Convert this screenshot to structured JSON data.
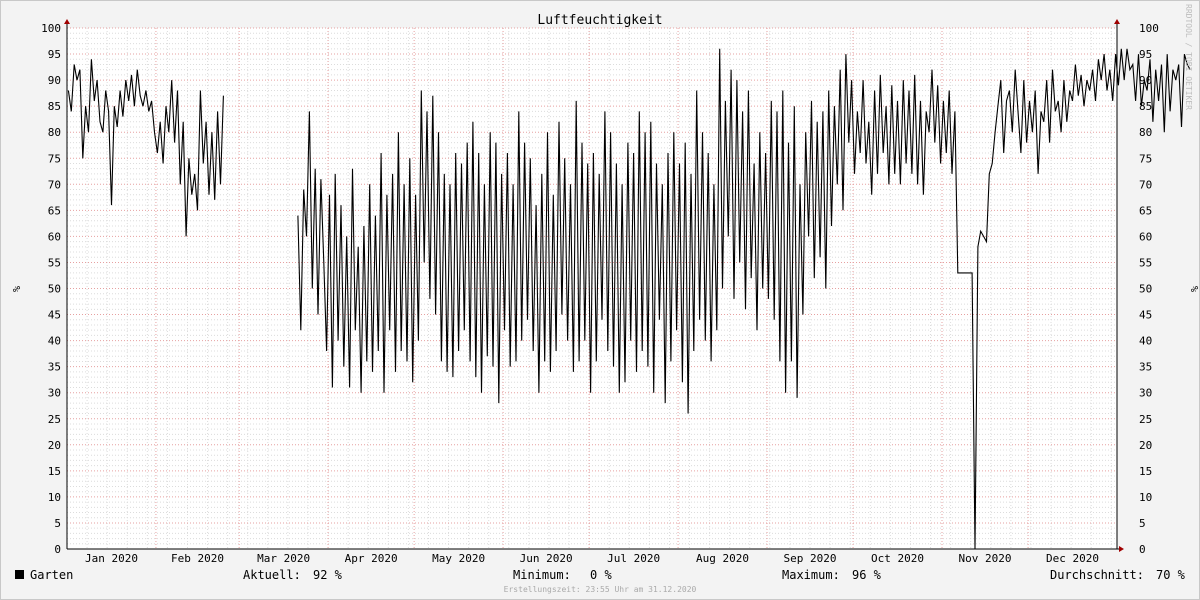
{
  "chart_data": {
    "type": "line",
    "title": "Luftfeuchtigkeit",
    "ylabel": "%",
    "ylim": [
      0,
      100
    ],
    "yticks": [
      "0",
      "5",
      "10",
      "15",
      "20",
      "25",
      "30",
      "35",
      "40",
      "45",
      "50",
      "55",
      "60",
      "65",
      "70",
      "75",
      "80",
      "85",
      "90",
      "95",
      "100"
    ],
    "xlim": [
      "2020-01-01",
      "2020-12-31"
    ],
    "month_labels": [
      "Jan 2020",
      "Feb 2020",
      "Mar 2020",
      "Apr 2020",
      "May 2020",
      "Jun 2020",
      "Jul 2020",
      "Aug 2020",
      "Sep 2020",
      "Oct 2020",
      "Nov 2020",
      "Dec 2020"
    ],
    "grid": true,
    "series": [
      {
        "name": "Garten",
        "segments": [
          {
            "start": "2020-01-01",
            "values": [
              88,
              84,
              93,
              90,
              92,
              75,
              85,
              80,
              94,
              86,
              90,
              82,
              80,
              88,
              84,
              66,
              85,
              81,
              88,
              83,
              90,
              86,
              91,
              85,
              92,
              87,
              85,
              88,
              84,
              86,
              80,
              76,
              82,
              74,
              85,
              80,
              90,
              78,
              88,
              70,
              82,
              60,
              75,
              68,
              72,
              65,
              88,
              74,
              82,
              68,
              80,
              67,
              84,
              70,
              87
            ]
          },
          {
            "start": "2020-03-21",
            "values": [
              64,
              42,
              69,
              60,
              84,
              50,
              73,
              45,
              71,
              55,
              38,
              68,
              31,
              72,
              40,
              66,
              35,
              60,
              31,
              73,
              42,
              58,
              30,
              62,
              36,
              70,
              34,
              64,
              38,
              76,
              30,
              68,
              42,
              72,
              34,
              80,
              38,
              70,
              36,
              75,
              32,
              68,
              40,
              88,
              55,
              84,
              48,
              87,
              45,
              80,
              36,
              72,
              34,
              70,
              33,
              76,
              38,
              74,
              42,
              78,
              36,
              82,
              33,
              76,
              30,
              70,
              37,
              80,
              35,
              78,
              28,
              72,
              42,
              76,
              35,
              70,
              36,
              84,
              40,
              78,
              44,
              75,
              38,
              66,
              30,
              72,
              36,
              80,
              34,
              68,
              38,
              82,
              45,
              75,
              40,
              70,
              34,
              86,
              36,
              78,
              40,
              74,
              30,
              76,
              36,
              72,
              44,
              84,
              38,
              80,
              35,
              74,
              30,
              70,
              32,
              78,
              40,
              76,
              34,
              84,
              38,
              80,
              35,
              82,
              30,
              74,
              44,
              70,
              28,
              76,
              36,
              80,
              42,
              74,
              32,
              78,
              26,
              72,
              38,
              88,
              44,
              80,
              40,
              76,
              36,
              70,
              42,
              96,
              50,
              86,
              60,
              92,
              48,
              90,
              55,
              84,
              46,
              88,
              52,
              74,
              42,
              80,
              50,
              76,
              48,
              86,
              44,
              84,
              36,
              88,
              30,
              78,
              36,
              85,
              29,
              70,
              45,
              80,
              60,
              86,
              52,
              82,
              56,
              84,
              50,
              88,
              62,
              85,
              70,
              92,
              65,
              95,
              78,
              90,
              72,
              84,
              76,
              90,
              74,
              82,
              68,
              88,
              72,
              91,
              76,
              85,
              70,
              89,
              72,
              86,
              70,
              90,
              74,
              88,
              72,
              91,
              70,
              86,
              68,
              84,
              80,
              92,
              78,
              89,
              74,
              86,
              76,
              88,
              72,
              84,
              53,
              53,
              53,
              53,
              53,
              53,
              0,
              58,
              61,
              60,
              59,
              72,
              74,
              80,
              85,
              90,
              76,
              86,
              88,
              80,
              92,
              84,
              76,
              90,
              78,
              86,
              80,
              88,
              72,
              84,
              82,
              90,
              78,
              92,
              84,
              86,
              80,
              90,
              82,
              88,
              86,
              93,
              87,
              91,
              85,
              90,
              88,
              92,
              86,
              94,
              90,
              95,
              88,
              92,
              86,
              95,
              89,
              96,
              90,
              96,
              92,
              93,
              86,
              95,
              85,
              90,
              88,
              94,
              82,
              92,
              86,
              93,
              80,
              95,
              84,
              92,
              90,
              93,
              81,
              95,
              93,
              92
            ]
          }
        ]
      }
    ]
  },
  "watermark": "RRDTOOL / TOBI OETIKER",
  "legend": {
    "series_name": "Garten",
    "current_label": "Aktuell:",
    "current_value": "92 %",
    "min_label": "Minimum:",
    "min_value": "0 %",
    "max_label": "Maximum:",
    "max_value": "96 %",
    "avg_label": "Durchschnitt:",
    "avg_value": "70 %"
  },
  "footer": "Erstellungszeit: 23:55 Uhr am 31.12.2020"
}
